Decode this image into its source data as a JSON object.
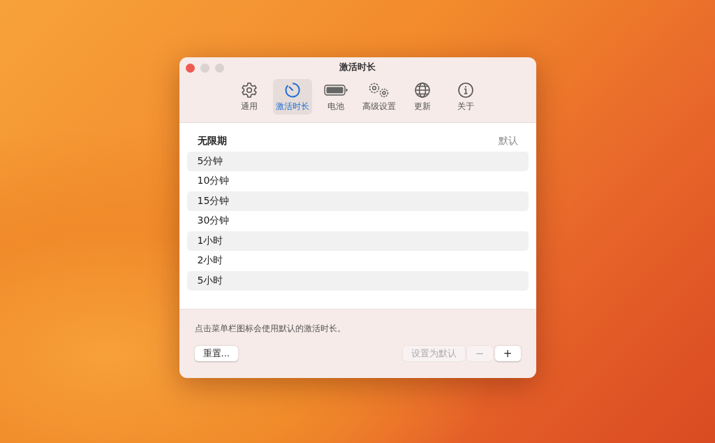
{
  "window": {
    "title": "激活时长"
  },
  "tabs": [
    {
      "label": "通用",
      "kind": "gear",
      "selected": false
    },
    {
      "label": "激活时长",
      "kind": "timer",
      "selected": true
    },
    {
      "label": "电池",
      "kind": "battery",
      "selected": false
    },
    {
      "label": "高级设置",
      "kind": "gears",
      "selected": false
    },
    {
      "label": "更新",
      "kind": "globe",
      "selected": false
    },
    {
      "label": "关于",
      "kind": "info",
      "selected": false
    }
  ],
  "durations": [
    {
      "label": "无限期",
      "default": true,
      "note": "默认"
    },
    {
      "label": "5分钟",
      "default": false
    },
    {
      "label": "10分钟",
      "default": false
    },
    {
      "label": "15分钟",
      "default": false
    },
    {
      "label": "30分钟",
      "default": false
    },
    {
      "label": "1小时",
      "default": false
    },
    {
      "label": "2小时",
      "default": false
    },
    {
      "label": "5小时",
      "default": false
    }
  ],
  "hint": "点击菜单栏图标会使用默认的激活时长。",
  "reset_button": {
    "label": "重置..."
  },
  "set_default_button": {
    "label": "设置为默认",
    "disabled": true
  },
  "remove_button": {
    "label": "−",
    "disabled": true
  },
  "add_button": {
    "label": "+",
    "disabled": false
  }
}
